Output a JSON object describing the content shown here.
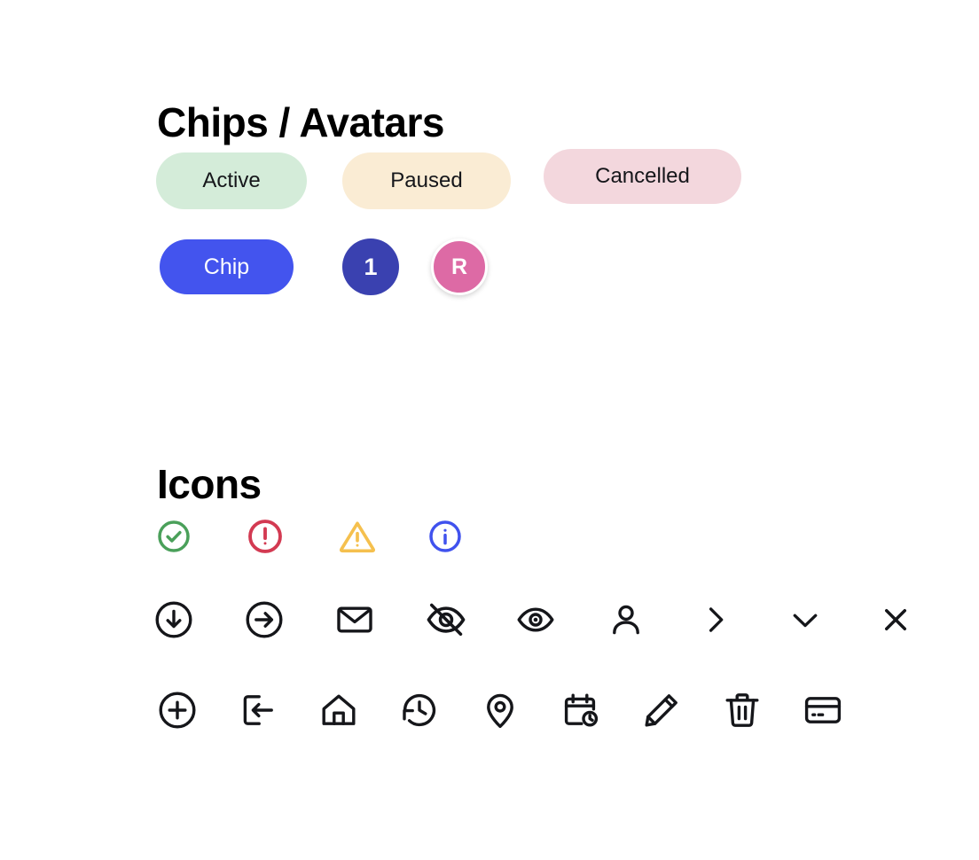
{
  "sections": {
    "chips": {
      "title": "Chips / Avatars"
    },
    "icons": {
      "title": "Icons"
    }
  },
  "status_chips": [
    {
      "label": "Active",
      "bg": "#d4ecd9",
      "fg": "#15161a"
    },
    {
      "label": "Paused",
      "bg": "#faecd4",
      "fg": "#15161a"
    },
    {
      "label": "Cancelled",
      "bg": "#f3d7dd",
      "fg": "#15161a"
    }
  ],
  "chip_row": {
    "chip": {
      "label": "Chip",
      "bg": "#4354ee",
      "fg": "#ffffff"
    },
    "badge": {
      "label": "1",
      "bg": "#3a41b0",
      "fg": "#ffffff"
    },
    "avatar": {
      "label": "R",
      "bg": "#dd6aa5",
      "fg": "#ffffff",
      "ring": "#ffffff"
    }
  },
  "colors": {
    "success": "#4aa05a",
    "error": "#d33a52",
    "warning": "#f5c04e",
    "info": "#4052ee",
    "ink": "#15161a",
    "page_bg": "#ffffff"
  },
  "icons": {
    "status_row": [
      {
        "name": "check-circle-icon",
        "label": "Success",
        "color": "#4aa05a"
      },
      {
        "name": "alert-circle-icon",
        "label": "Error",
        "color": "#d33a52"
      },
      {
        "name": "warning-triangle-icon",
        "label": "Warning",
        "color": "#f5c04e"
      },
      {
        "name": "info-circle-icon",
        "label": "Info",
        "color": "#4052ee"
      }
    ],
    "ui_row": [
      {
        "name": "download-circle-icon",
        "label": "Download"
      },
      {
        "name": "arrow-right-circle-icon",
        "label": "Next"
      },
      {
        "name": "mail-icon",
        "label": "Mail"
      },
      {
        "name": "eye-off-icon",
        "label": "Hide"
      },
      {
        "name": "eye-icon",
        "label": "Show"
      },
      {
        "name": "user-icon",
        "label": "User"
      },
      {
        "name": "chevron-right-icon",
        "label": "Expand"
      },
      {
        "name": "chevron-down-icon",
        "label": "Dropdown"
      },
      {
        "name": "close-icon",
        "label": "Close"
      }
    ],
    "action_row": [
      {
        "name": "plus-circle-icon",
        "label": "Add"
      },
      {
        "name": "logout-icon",
        "label": "Log out"
      },
      {
        "name": "home-icon",
        "label": "Home"
      },
      {
        "name": "history-icon",
        "label": "History"
      },
      {
        "name": "map-pin-icon",
        "label": "Location"
      },
      {
        "name": "calendar-clock-icon",
        "label": "Schedule"
      },
      {
        "name": "pencil-icon",
        "label": "Edit"
      },
      {
        "name": "trash-icon",
        "label": "Delete"
      },
      {
        "name": "credit-card-icon",
        "label": "Payment"
      }
    ]
  }
}
